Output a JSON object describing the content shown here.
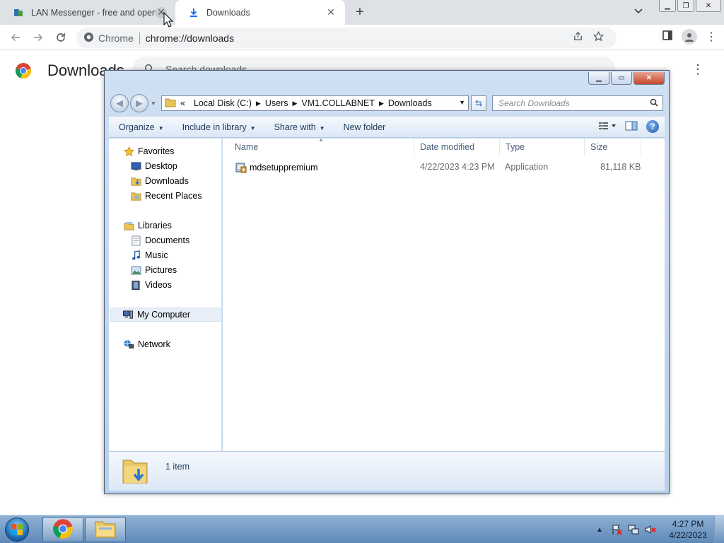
{
  "browser": {
    "tabs": [
      {
        "title": "LAN Messenger - free and open",
        "active": false
      },
      {
        "title": "Downloads",
        "active": true
      }
    ],
    "new_tab_label": "+",
    "omnibox": {
      "site_label": "Chrome",
      "url": "chrome://downloads"
    }
  },
  "downloads_page": {
    "title": "Downloads",
    "search_placeholder": "Search downloads"
  },
  "explorer": {
    "breadcrumb": {
      "overflow": "«",
      "items": [
        "Local Disk (C:)",
        "Users",
        "VM1.COLLABNET",
        "Downloads"
      ]
    },
    "search_placeholder": "Search Downloads",
    "toolbar": {
      "organize": "Organize",
      "include_in_library": "Include in library",
      "share_with": "Share with",
      "new_folder": "New folder"
    },
    "nav": {
      "favorites": "Favorites",
      "favorites_items": [
        "Desktop",
        "Downloads",
        "Recent Places"
      ],
      "libraries": "Libraries",
      "libraries_items": [
        "Documents",
        "Music",
        "Pictures",
        "Videos"
      ],
      "computer": "My Computer",
      "network": "Network"
    },
    "columns": {
      "name": "Name",
      "date": "Date modified",
      "type": "Type",
      "size": "Size"
    },
    "files": [
      {
        "name": "mdsetuppremium",
        "date": "4/22/2023 4:23 PM",
        "type": "Application",
        "size": "81,118 KB"
      }
    ],
    "status": "1 item"
  },
  "taskbar": {
    "time": "4:27 PM",
    "date": "4/22/2023"
  },
  "colors": {
    "chrome_tabstrip": "#dee1e6",
    "explorer_frame": "#b8d0ea",
    "taskbar": "#5d88b7"
  }
}
